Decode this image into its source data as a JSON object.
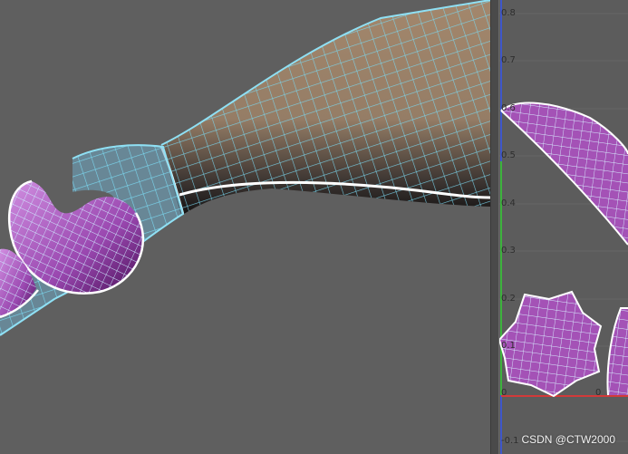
{
  "viewport3d": {
    "mesh_shell_color": "#7ad6ee",
    "mesh_skin_color": "#a3876c",
    "mesh_uv_color": "#a452b6",
    "seam_color": "#ffffff",
    "background": "#5f5f5f"
  },
  "uv_editor": {
    "axis_ticks": [
      "0.8",
      "0.7",
      "0.6",
      "0.5",
      "0.4",
      "0.3",
      "0.2",
      "0.1",
      "0",
      "0",
      "-0.1"
    ],
    "axis_u_color": "#d23a3a",
    "axis_v_color": "#3db33d",
    "axis_border_color": "#3f57c9",
    "shell_fill_color": "#a452b6",
    "shell_line_color": "#c8e8ff"
  },
  "watermark": "CSDN @CTW2000"
}
